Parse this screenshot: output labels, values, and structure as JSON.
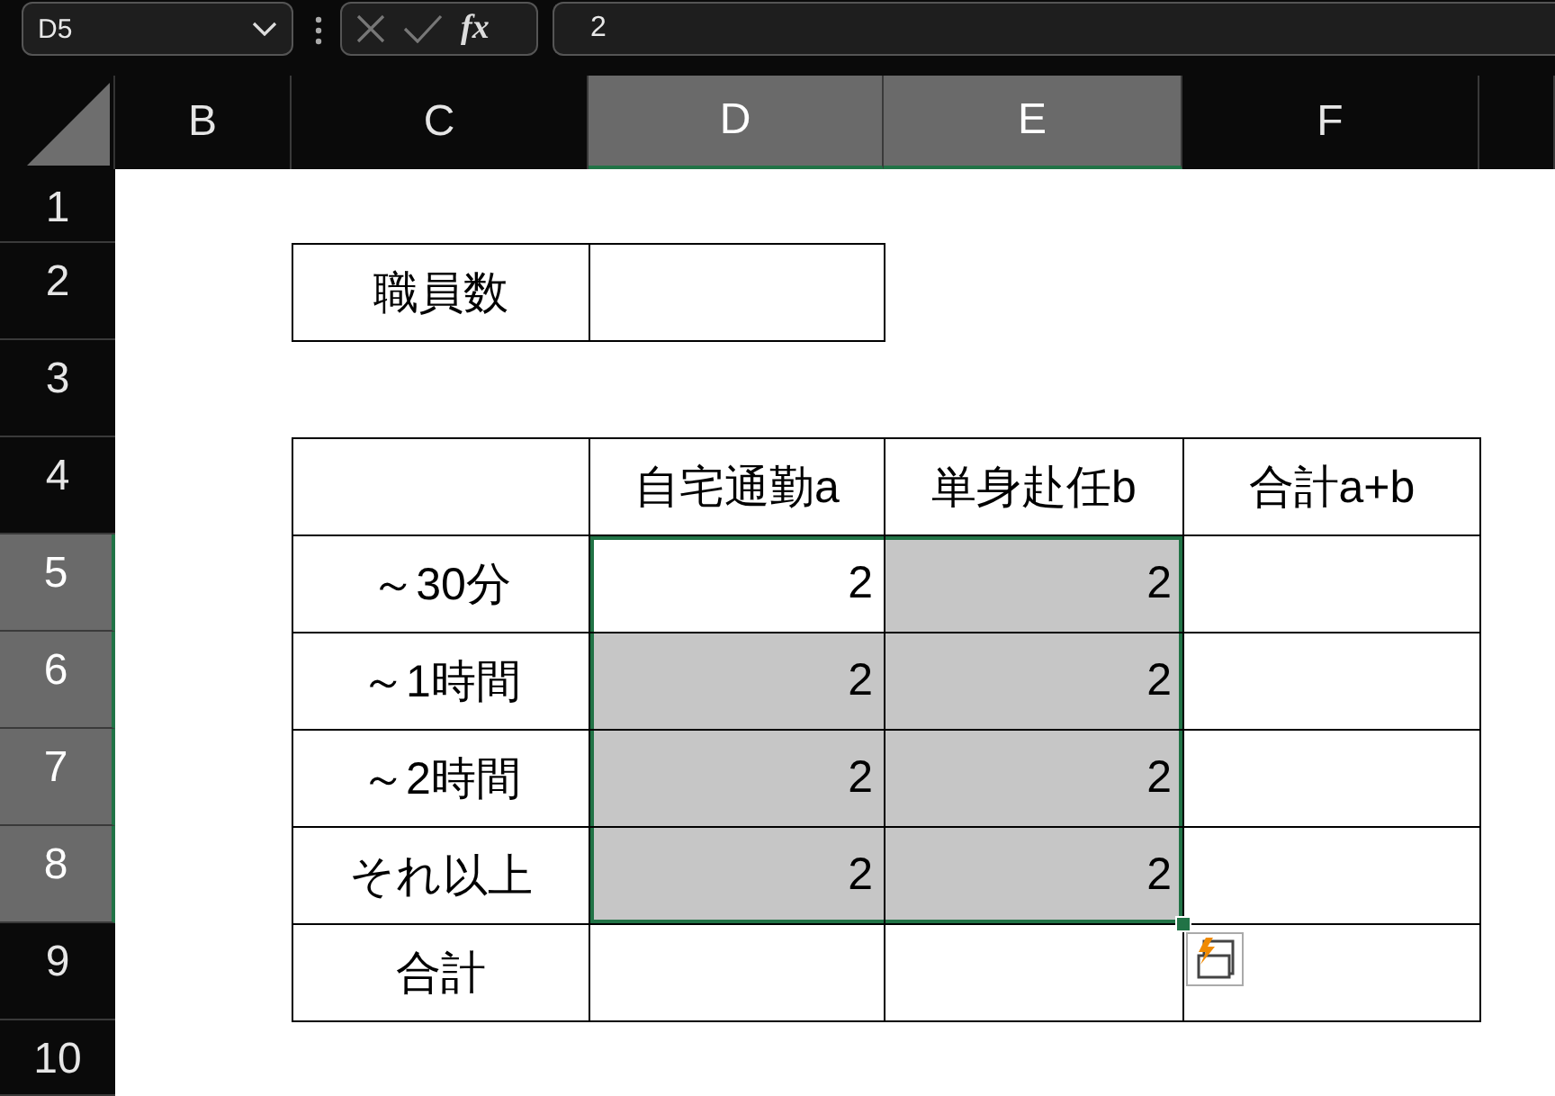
{
  "formula_bar": {
    "name_box": "D5",
    "fx": "fx",
    "formula": "2"
  },
  "columns": [
    {
      "label": "B",
      "selected": false
    },
    {
      "label": "C",
      "selected": false
    },
    {
      "label": "D",
      "selected": true
    },
    {
      "label": "E",
      "selected": true
    },
    {
      "label": "F",
      "selected": false
    },
    {
      "selected": false
    }
  ],
  "rows": [
    {
      "label": "1",
      "selected": false
    },
    {
      "label": "2",
      "selected": false
    },
    {
      "label": "3",
      "selected": false
    },
    {
      "label": "4",
      "selected": false
    },
    {
      "label": "5",
      "selected": true
    },
    {
      "label": "6",
      "selected": true
    },
    {
      "label": "7",
      "selected": true
    },
    {
      "label": "8",
      "selected": true
    },
    {
      "label": "9",
      "selected": false
    },
    {
      "label": "10",
      "selected": false
    }
  ],
  "tables": [
    {
      "kind": "staff",
      "rows": [
        [
          {
            "text": "職員数",
            "kind": "text",
            "selected": false
          },
          null
        ]
      ]
    },
    {
      "kind": "commute",
      "rows": [
        [
          null,
          {
            "text": "自宅通勤a",
            "kind": "text",
            "selected": false
          },
          {
            "text": "単身赴任b",
            "kind": "text",
            "selected": false
          },
          {
            "text": "合計a+b",
            "kind": "text",
            "selected": false
          }
        ],
        [
          {
            "text": "～30分",
            "kind": "text",
            "selected": false
          },
          {
            "text": "2",
            "kind": "number",
            "selected": true
          },
          {
            "text": "2",
            "kind": "number",
            "selected": true
          },
          null
        ],
        [
          {
            "text": "～1時間",
            "kind": "text",
            "selected": false
          },
          {
            "text": "2",
            "kind": "number",
            "selected": true
          },
          {
            "text": "2",
            "kind": "number",
            "selected": true
          },
          null
        ],
        [
          {
            "text": "～2時間",
            "kind": "text",
            "selected": false
          },
          {
            "text": "2",
            "kind": "number",
            "selected": true
          },
          {
            "text": "2",
            "kind": "number",
            "selected": true
          },
          null
        ],
        [
          {
            "text": "それ以上",
            "kind": "text",
            "selected": false
          },
          {
            "text": "2",
            "kind": "number",
            "selected": true
          },
          {
            "text": "2",
            "kind": "number",
            "selected": true
          },
          null
        ],
        [
          {
            "text": "合計",
            "kind": "text",
            "selected": false
          },
          null,
          null,
          null
        ]
      ]
    }
  ]
}
